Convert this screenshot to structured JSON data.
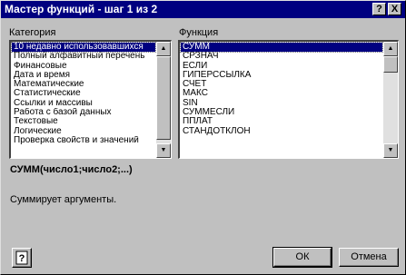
{
  "window": {
    "title": "Мастер функций - шаг 1 из 2",
    "help_button": "?",
    "close_button": "X"
  },
  "category": {
    "label": "Категория",
    "items": [
      "10 недавно использовавшихся",
      "Полный алфавитный перечень",
      "Финансовые",
      "Дата и время",
      "Математические",
      "Статистические",
      "Ссылки и массивы",
      "Работа с базой данных",
      "Текстовые",
      "Логические",
      "Проверка свойств и значений"
    ],
    "selected_index": 0
  },
  "function": {
    "label": "Функция",
    "items": [
      "СУММ",
      "СРЗНАЧ",
      "ЕСЛИ",
      "ГИПЕРССЫЛКА",
      "СЧЁТ",
      "МАКС",
      "SIN",
      "СУММЕСЛИ",
      "ППЛАТ",
      "СТАНДОТКЛОН"
    ],
    "selected_index": 0
  },
  "syntax": "СУММ(число1;число2;...)",
  "description": "Суммирует аргументы.",
  "buttons": {
    "ok": "ОК",
    "cancel": "Отмена",
    "help_icon": "help-question-icon"
  },
  "colors": {
    "titlebar": "#000080",
    "selection": "#000080",
    "face": "#c0c0c0"
  }
}
